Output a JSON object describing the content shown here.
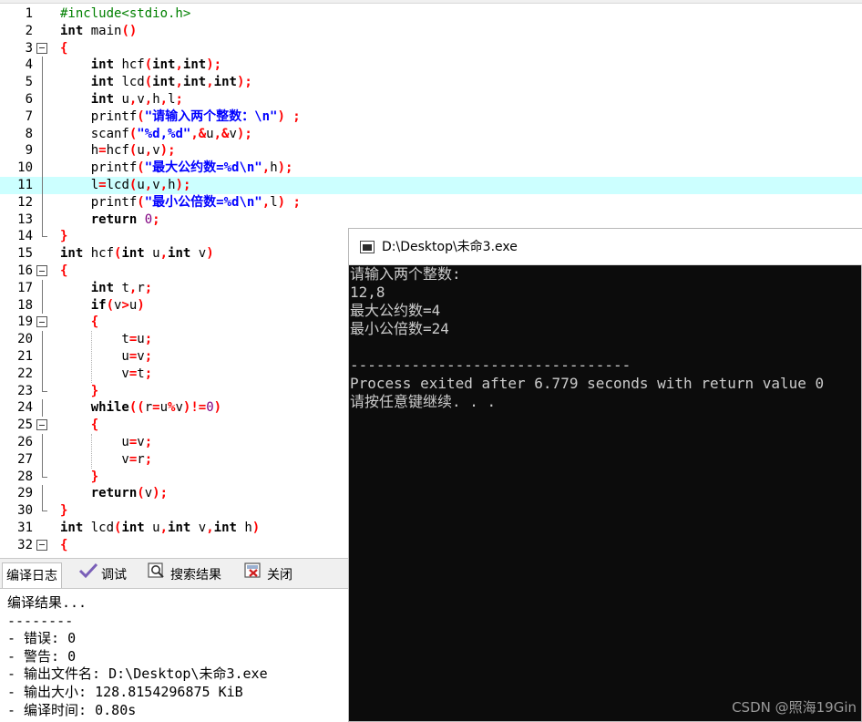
{
  "editor": {
    "highlighted_line": 11,
    "lines": [
      {
        "n": "1",
        "fold": "",
        "segs": [
          [
            "cm",
            "#include<stdio.h>"
          ]
        ]
      },
      {
        "n": "2",
        "fold": "",
        "segs": [
          [
            "kw",
            "int"
          ],
          [
            "id",
            " main"
          ],
          [
            "sym",
            "()"
          ]
        ]
      },
      {
        "n": "3",
        "fold": "open",
        "segs": [
          [
            "sym",
            "{"
          ]
        ]
      },
      {
        "n": "4",
        "fold": "v",
        "segs": [
          [
            "id",
            "    "
          ],
          [
            "kw",
            "int"
          ],
          [
            "id",
            " hcf"
          ],
          [
            "sym",
            "("
          ],
          [
            "kw",
            "int"
          ],
          [
            "sym",
            ","
          ],
          [
            "kw",
            "int"
          ],
          [
            "sym",
            ");"
          ]
        ]
      },
      {
        "n": "5",
        "fold": "v",
        "segs": [
          [
            "id",
            "    "
          ],
          [
            "kw",
            "int"
          ],
          [
            "id",
            " lcd"
          ],
          [
            "sym",
            "("
          ],
          [
            "kw",
            "int"
          ],
          [
            "sym",
            ","
          ],
          [
            "kw",
            "int"
          ],
          [
            "sym",
            ","
          ],
          [
            "kw",
            "int"
          ],
          [
            "sym",
            ");"
          ]
        ]
      },
      {
        "n": "6",
        "fold": "v",
        "segs": [
          [
            "id",
            "    "
          ],
          [
            "kw",
            "int"
          ],
          [
            "id",
            " u"
          ],
          [
            "sym",
            ","
          ],
          [
            "id",
            "v"
          ],
          [
            "sym",
            ","
          ],
          [
            "id",
            "h"
          ],
          [
            "sym",
            ","
          ],
          [
            "id",
            "l"
          ],
          [
            "sym",
            ";"
          ]
        ]
      },
      {
        "n": "7",
        "fold": "v",
        "segs": [
          [
            "id",
            "    printf"
          ],
          [
            "sym",
            "("
          ],
          [
            "str",
            "\"请输入两个整数：\\n\""
          ],
          [
            "sym",
            ") ;"
          ]
        ]
      },
      {
        "n": "8",
        "fold": "v",
        "segs": [
          [
            "id",
            "    scanf"
          ],
          [
            "sym",
            "("
          ],
          [
            "str",
            "\"%d,%d\""
          ],
          [
            "sym",
            ",&"
          ],
          [
            "id",
            "u"
          ],
          [
            "sym",
            ",&"
          ],
          [
            "id",
            "v"
          ],
          [
            "sym",
            ");"
          ]
        ]
      },
      {
        "n": "9",
        "fold": "v",
        "segs": [
          [
            "id",
            "    h"
          ],
          [
            "sym",
            "="
          ],
          [
            "id",
            "hcf"
          ],
          [
            "sym",
            "("
          ],
          [
            "id",
            "u"
          ],
          [
            "sym",
            ","
          ],
          [
            "id",
            "v"
          ],
          [
            "sym",
            ");"
          ]
        ]
      },
      {
        "n": "10",
        "fold": "v",
        "segs": [
          [
            "id",
            "    printf"
          ],
          [
            "sym",
            "("
          ],
          [
            "str",
            "\"最大公约数=%d\\n\""
          ],
          [
            "sym",
            ","
          ],
          [
            "id",
            "h"
          ],
          [
            "sym",
            ");"
          ]
        ]
      },
      {
        "n": "11",
        "fold": "v",
        "segs": [
          [
            "id",
            "    l"
          ],
          [
            "sym",
            "="
          ],
          [
            "id",
            "lcd"
          ],
          [
            "sym",
            "("
          ],
          [
            "id",
            "u"
          ],
          [
            "sym",
            ","
          ],
          [
            "id",
            "v"
          ],
          [
            "sym",
            ","
          ],
          [
            "id",
            "h"
          ],
          [
            "sym",
            ");"
          ]
        ]
      },
      {
        "n": "12",
        "fold": "v",
        "segs": [
          [
            "id",
            "    printf"
          ],
          [
            "sym",
            "("
          ],
          [
            "str",
            "\"最小公倍数=%d\\n\""
          ],
          [
            "sym",
            ","
          ],
          [
            "id",
            "l"
          ],
          [
            "sym",
            ") ;"
          ]
        ]
      },
      {
        "n": "13",
        "fold": "v",
        "segs": [
          [
            "id",
            "    "
          ],
          [
            "kw",
            "return"
          ],
          [
            "id",
            " "
          ],
          [
            "num",
            "0"
          ],
          [
            "sym",
            ";"
          ]
        ]
      },
      {
        "n": "14",
        "fold": "end",
        "segs": [
          [
            "sym",
            "}"
          ]
        ]
      },
      {
        "n": "15",
        "fold": "",
        "segs": [
          [
            "kw",
            "int"
          ],
          [
            "id",
            " hcf"
          ],
          [
            "sym",
            "("
          ],
          [
            "kw",
            "int"
          ],
          [
            "id",
            " u"
          ],
          [
            "sym",
            ","
          ],
          [
            "kw",
            "int"
          ],
          [
            "id",
            " v"
          ],
          [
            "sym",
            ")"
          ]
        ]
      },
      {
        "n": "16",
        "fold": "open",
        "segs": [
          [
            "sym",
            "{"
          ]
        ]
      },
      {
        "n": "17",
        "fold": "v",
        "segs": [
          [
            "id",
            "    "
          ],
          [
            "kw",
            "int"
          ],
          [
            "id",
            " t"
          ],
          [
            "sym",
            ","
          ],
          [
            "id",
            "r"
          ],
          [
            "sym",
            ";"
          ]
        ]
      },
      {
        "n": "18",
        "fold": "v",
        "segs": [
          [
            "id",
            "    "
          ],
          [
            "kw",
            "if"
          ],
          [
            "sym",
            "("
          ],
          [
            "id",
            "v"
          ],
          [
            "sym",
            ">"
          ],
          [
            "id",
            "u"
          ],
          [
            "sym",
            ")"
          ]
        ]
      },
      {
        "n": "19",
        "fold": "open",
        "segs": [
          [
            "id",
            "    "
          ],
          [
            "sym",
            "{"
          ]
        ]
      },
      {
        "n": "20",
        "fold": "v",
        "segs": [
          [
            "id",
            "        t"
          ],
          [
            "sym",
            "="
          ],
          [
            "id",
            "u"
          ],
          [
            "sym",
            ";"
          ]
        ]
      },
      {
        "n": "21",
        "fold": "v",
        "segs": [
          [
            "id",
            "        u"
          ],
          [
            "sym",
            "="
          ],
          [
            "id",
            "v"
          ],
          [
            "sym",
            ";"
          ]
        ]
      },
      {
        "n": "22",
        "fold": "v",
        "segs": [
          [
            "id",
            "        v"
          ],
          [
            "sym",
            "="
          ],
          [
            "id",
            "t"
          ],
          [
            "sym",
            ";"
          ]
        ]
      },
      {
        "n": "23",
        "fold": "end",
        "segs": [
          [
            "id",
            "    "
          ],
          [
            "sym",
            "}"
          ]
        ]
      },
      {
        "n": "24",
        "fold": "v",
        "segs": [
          [
            "id",
            "    "
          ],
          [
            "kw",
            "while"
          ],
          [
            "sym",
            "(("
          ],
          [
            "id",
            "r"
          ],
          [
            "sym",
            "="
          ],
          [
            "id",
            "u"
          ],
          [
            "sym",
            "%"
          ],
          [
            "id",
            "v"
          ],
          [
            "sym",
            ")!="
          ],
          [
            "num",
            "0"
          ],
          [
            "sym",
            ")"
          ]
        ]
      },
      {
        "n": "25",
        "fold": "open",
        "segs": [
          [
            "id",
            "    "
          ],
          [
            "sym",
            "{"
          ]
        ]
      },
      {
        "n": "26",
        "fold": "v",
        "segs": [
          [
            "id",
            "        u"
          ],
          [
            "sym",
            "="
          ],
          [
            "id",
            "v"
          ],
          [
            "sym",
            ";"
          ]
        ]
      },
      {
        "n": "27",
        "fold": "v",
        "segs": [
          [
            "id",
            "        v"
          ],
          [
            "sym",
            "="
          ],
          [
            "id",
            "r"
          ],
          [
            "sym",
            ";"
          ]
        ]
      },
      {
        "n": "28",
        "fold": "end",
        "segs": [
          [
            "id",
            "    "
          ],
          [
            "sym",
            "}"
          ]
        ]
      },
      {
        "n": "29",
        "fold": "v",
        "segs": [
          [
            "id",
            "    "
          ],
          [
            "kw",
            "return"
          ],
          [
            "sym",
            "("
          ],
          [
            "id",
            "v"
          ],
          [
            "sym",
            ");"
          ]
        ]
      },
      {
        "n": "30",
        "fold": "end",
        "segs": [
          [
            "sym",
            "}"
          ]
        ]
      },
      {
        "n": "31",
        "fold": "",
        "segs": [
          [
            "kw",
            "int"
          ],
          [
            "id",
            " lcd"
          ],
          [
            "sym",
            "("
          ],
          [
            "kw",
            "int"
          ],
          [
            "id",
            " u"
          ],
          [
            "sym",
            ","
          ],
          [
            "kw",
            "int"
          ],
          [
            "id",
            " v"
          ],
          [
            "sym",
            ","
          ],
          [
            "kw",
            "int"
          ],
          [
            "id",
            " h"
          ],
          [
            "sym",
            ")"
          ]
        ]
      },
      {
        "n": "32",
        "fold": "open",
        "segs": [
          [
            "sym",
            "{"
          ]
        ]
      }
    ]
  },
  "tabs": [
    {
      "label": "编译日志",
      "icon": "compile-log-icon"
    },
    {
      "label": "调试",
      "icon": "debug-check-icon"
    },
    {
      "label": "搜索结果",
      "icon": "search-results-icon"
    },
    {
      "label": "关闭",
      "icon": "close-panel-icon"
    }
  ],
  "log": [
    "编译结果...",
    "--------",
    "- 错误: 0",
    "- 警告: 0",
    "- 输出文件名: D:\\Desktop\\未命3.exe",
    "- 输出大小: 128.8154296875 KiB",
    "- 编译时间: 0.80s"
  ],
  "console": {
    "title": "D:\\Desktop\\未命3.exe",
    "lines": [
      "请输入两个整数:",
      "12,8",
      "最大公约数=4",
      "最小公倍数=24",
      "",
      "--------------------------------",
      "Process exited after 6.779 seconds with return value 0",
      "请按任意键继续. . ."
    ]
  },
  "watermark": "CSDN @照海19Gin",
  "colors": {
    "line_highlight": "#ccffff",
    "keyword": "#000000",
    "symbol": "#ff0000",
    "string": "#0000ff",
    "comment": "#008000",
    "number": "#800080",
    "console_bg": "#0c0c0c",
    "console_fg": "#cccccc"
  }
}
